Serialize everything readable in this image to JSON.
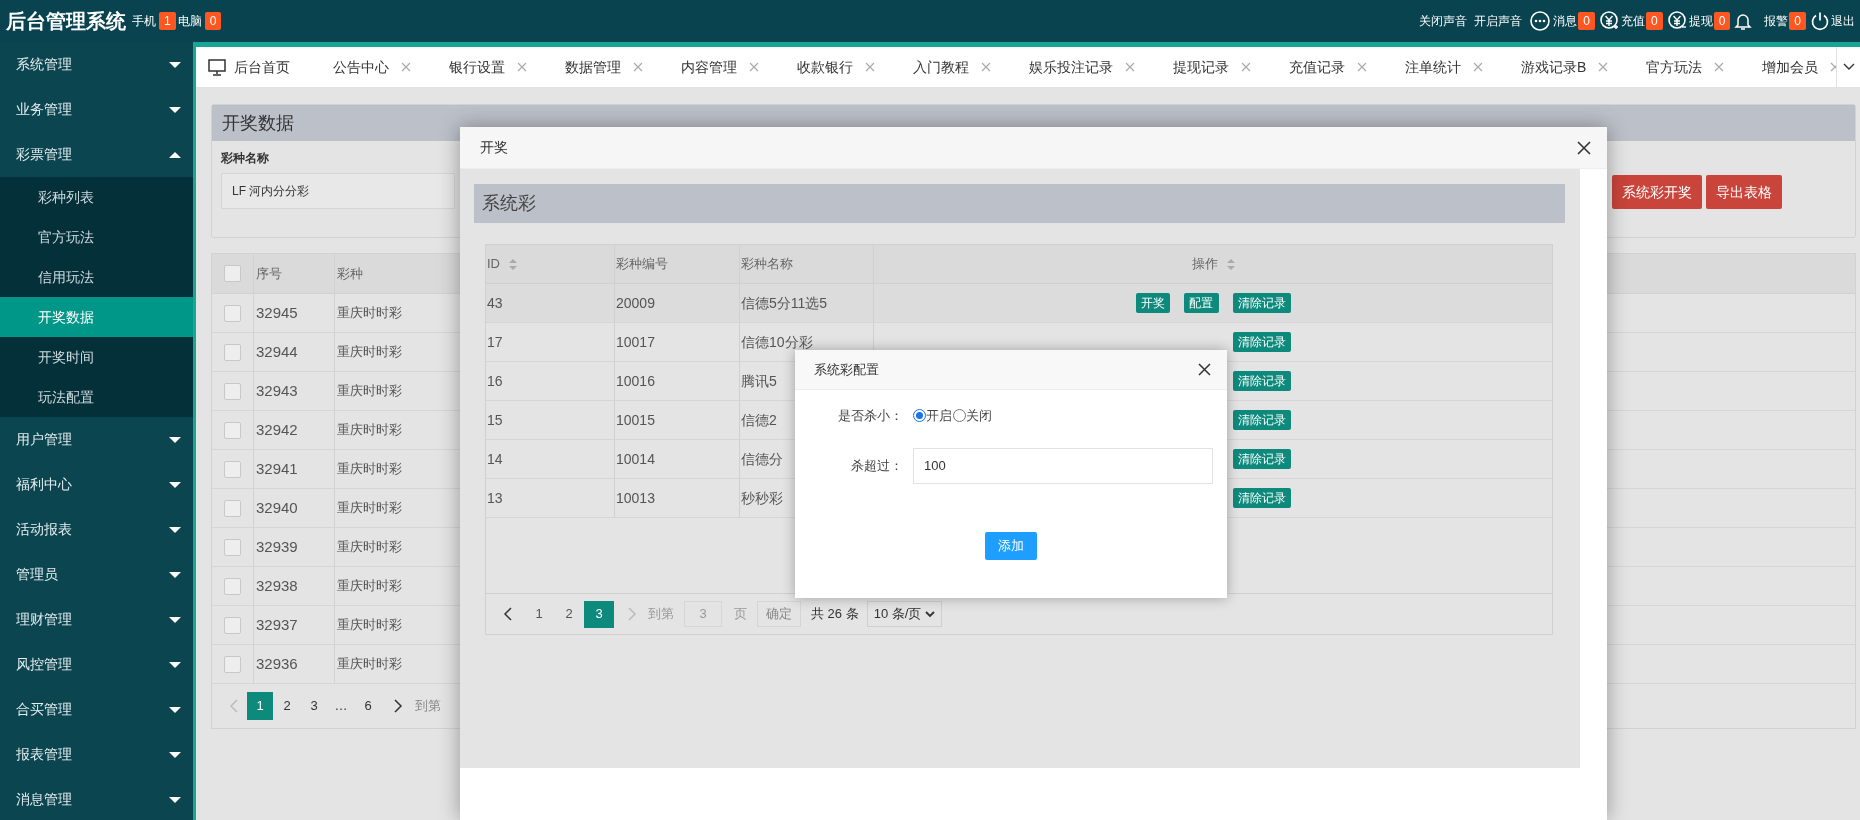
{
  "header": {
    "title": "后台管理系统",
    "badges": [
      {
        "label": "手机",
        "count": "1"
      },
      {
        "label": "电脑",
        "count": "0"
      }
    ],
    "actions": [
      {
        "kind": "text",
        "label": "关闭声音"
      },
      {
        "kind": "text",
        "label": "开启声音"
      },
      {
        "kind": "message",
        "label": "消息",
        "count": "0"
      },
      {
        "kind": "recharge",
        "label": "充值",
        "count": "0"
      },
      {
        "kind": "withdraw",
        "label": "提现",
        "count": "0"
      },
      {
        "kind": "alarm",
        "label": "报警",
        "count": "0"
      },
      {
        "kind": "logout",
        "label": "退出"
      }
    ]
  },
  "sidebar": {
    "items": [
      {
        "label": "系统管理",
        "expanded": false
      },
      {
        "label": "业务管理",
        "expanded": false
      },
      {
        "label": "彩票管理",
        "expanded": true,
        "children": [
          {
            "label": "彩种列表",
            "selected": false
          },
          {
            "label": "官方玩法",
            "selected": false
          },
          {
            "label": "信用玩法",
            "selected": false
          },
          {
            "label": "开奖数据",
            "selected": true
          },
          {
            "label": "开奖时间",
            "selected": false
          },
          {
            "label": "玩法配置",
            "selected": false
          }
        ]
      },
      {
        "label": "用户管理",
        "expanded": false
      },
      {
        "label": "福利中心",
        "expanded": false
      },
      {
        "label": "活动报表",
        "expanded": false
      },
      {
        "label": "管理员",
        "expanded": false
      },
      {
        "label": "理财管理",
        "expanded": false
      },
      {
        "label": "风控管理",
        "expanded": false
      },
      {
        "label": "合买管理",
        "expanded": false
      },
      {
        "label": "报表管理",
        "expanded": false
      },
      {
        "label": "消息管理",
        "expanded": false
      }
    ]
  },
  "tabs": [
    {
      "kind": "home",
      "label": "后台首页"
    },
    {
      "kind": "page",
      "label": "公告中心"
    },
    {
      "kind": "page",
      "label": "银行设置"
    },
    {
      "kind": "page",
      "label": "数据管理"
    },
    {
      "kind": "page",
      "label": "内容管理"
    },
    {
      "kind": "page",
      "label": "收款银行"
    },
    {
      "kind": "page",
      "label": "入门教程"
    },
    {
      "kind": "page",
      "label": "娱乐投注记录"
    },
    {
      "kind": "page",
      "label": "提现记录"
    },
    {
      "kind": "page",
      "label": "充值记录"
    },
    {
      "kind": "page",
      "label": "注单统计"
    },
    {
      "kind": "page",
      "label": "游戏记录B"
    },
    {
      "kind": "page",
      "label": "官方玩法"
    },
    {
      "kind": "page",
      "label": "增加会员"
    }
  ],
  "page": {
    "title": "开奖数据",
    "filter": {
      "label": "彩种名称",
      "value": "LF 河内分分彩"
    },
    "buttons": [
      "系统彩开奖",
      "导出表格"
    ],
    "table": {
      "header_checked": false,
      "columns": [
        "序号",
        "彩种"
      ],
      "rows": [
        {
          "checked": false,
          "cells": [
            "32945",
            "重庆时时彩"
          ]
        },
        {
          "checked": false,
          "cells": [
            "32944",
            "重庆时时彩"
          ]
        },
        {
          "checked": false,
          "cells": [
            "32943",
            "重庆时时彩"
          ]
        },
        {
          "checked": false,
          "cells": [
            "32942",
            "重庆时时彩"
          ]
        },
        {
          "checked": false,
          "cells": [
            "32941",
            "重庆时时彩"
          ]
        },
        {
          "checked": false,
          "cells": [
            "32940",
            "重庆时时彩"
          ]
        },
        {
          "checked": false,
          "cells": [
            "32939",
            "重庆时时彩"
          ]
        },
        {
          "checked": false,
          "cells": [
            "32938",
            "重庆时时彩"
          ]
        },
        {
          "checked": false,
          "cells": [
            "32937",
            "重庆时时彩"
          ]
        },
        {
          "checked": false,
          "cells": [
            "32936",
            "重庆时时彩"
          ]
        }
      ]
    },
    "pagination": {
      "pages": [
        {
          "label": "1",
          "selected": true
        },
        {
          "label": "2",
          "selected": false
        },
        {
          "label": "3",
          "selected": false
        },
        {
          "label": "…",
          "selected": false
        },
        {
          "label": "6",
          "selected": false
        }
      ],
      "goto_label": "到第"
    }
  },
  "dialog": {
    "title": "开奖",
    "section_title": "系统彩",
    "table": {
      "columns": [
        {
          "label": "ID",
          "sortable": true
        },
        {
          "label": "彩种编号",
          "sortable": false
        },
        {
          "label": "彩种名称",
          "sortable": false
        },
        {
          "label": "操作",
          "sortable": true
        }
      ],
      "rows": [
        {
          "cells": [
            "43",
            "20009",
            "信德5分11选5"
          ],
          "actions": [
            "开奖",
            "配置",
            "清除记录"
          ]
        },
        {
          "cells": [
            "17",
            "10017",
            "信德10分彩"
          ],
          "actions": [
            "清除记录"
          ]
        },
        {
          "cells": [
            "16",
            "10016",
            "腾讯5"
          ],
          "actions": [
            "清除记录"
          ]
        },
        {
          "cells": [
            "15",
            "10015",
            "信德2"
          ],
          "actions": [
            "清除记录"
          ]
        },
        {
          "cells": [
            "14",
            "10014",
            "信德分"
          ],
          "actions": [
            "清除记录"
          ]
        },
        {
          "cells": [
            "13",
            "10013",
            "秒秒彩"
          ],
          "actions": [
            "清除记录"
          ]
        }
      ]
    },
    "pagination": {
      "pages": [
        {
          "label": "1",
          "selected": false
        },
        {
          "label": "2",
          "selected": false
        },
        {
          "label": "3",
          "selected": true
        }
      ],
      "goto_label": "到第",
      "goto_value": "3",
      "page_unit": "页",
      "confirm": "确定",
      "total": "共 26 条",
      "page_size": "10 条/页"
    }
  },
  "config_dialog": {
    "title": "系统彩配置",
    "fields": [
      {
        "kind": "radio",
        "label": "是否杀小：",
        "options": [
          {
            "label": "开启",
            "selected": true
          },
          {
            "label": "关闭",
            "selected": false
          }
        ]
      },
      {
        "kind": "text",
        "label": "杀超过：",
        "value": "100"
      }
    ],
    "submit": "添加"
  }
}
